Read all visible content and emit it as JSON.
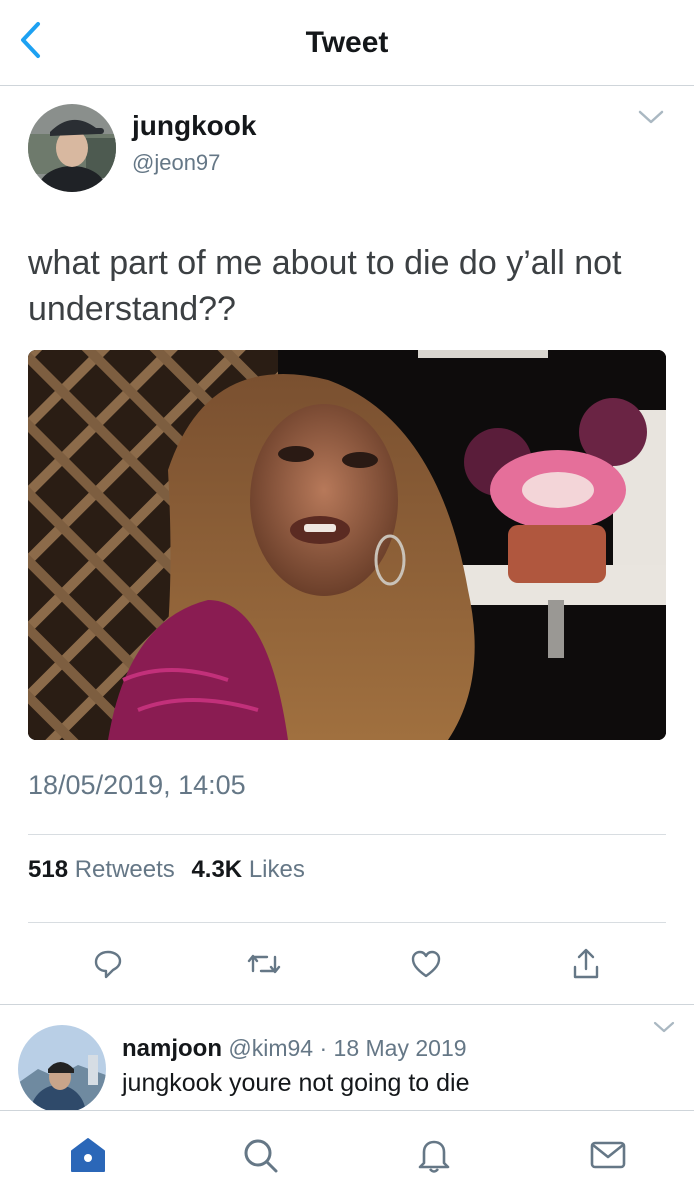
{
  "nav": {
    "title": "Tweet",
    "back_icon": "chevron-left-icon"
  },
  "tweet": {
    "author_name": "jungkook",
    "author_handle": "@jeon97",
    "text": "what part of me about to die do y’all not understand??",
    "timestamp": "18/05/2019, 14:05",
    "retweets_count": "518",
    "retweets_label": "Retweets",
    "likes_count": "4.3K",
    "likes_label": "Likes",
    "media_icon": "photo",
    "caret_icon": "chevron-down-icon"
  },
  "actions": [
    {
      "icon": "reply-icon"
    },
    {
      "icon": "retweet-icon"
    },
    {
      "icon": "heart-icon"
    },
    {
      "icon": "share-icon"
    }
  ],
  "reply": {
    "name": "namjoon",
    "handle": "@kim94",
    "separator": "·",
    "date": "18 May 2019",
    "text": "jungkook youre not going to die"
  },
  "tabbar": [
    {
      "icon": "home-icon",
      "active": true
    },
    {
      "icon": "search-icon",
      "active": false
    },
    {
      "icon": "bell-icon",
      "active": false
    },
    {
      "icon": "mail-icon",
      "active": false
    }
  ],
  "colors": {
    "accent": "#1da1f2",
    "home_active": "#2b67b8",
    "secondary_text": "#657786",
    "icon_gray": "#657786",
    "divider": "#d8dde1"
  }
}
